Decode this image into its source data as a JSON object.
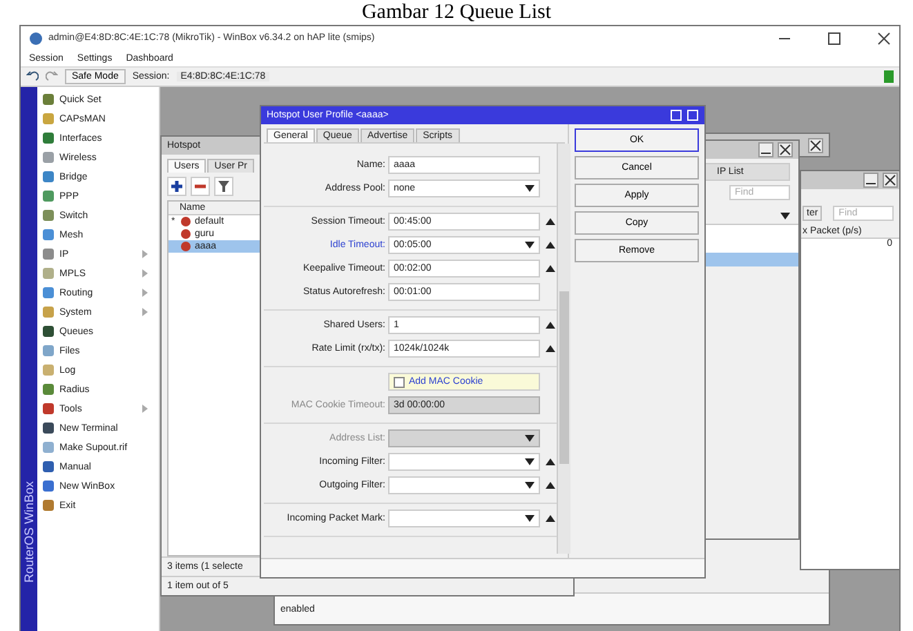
{
  "caption": "Gambar 12 Queue List",
  "window": {
    "title": "admin@E4:8D:8C:4E:1C:78 (MikroTik) - WinBox v6.34.2 on hAP lite (smips)",
    "menu": [
      "Session",
      "Settings",
      "Dashboard"
    ],
    "safe_mode": "Safe Mode",
    "session_label": "Session:",
    "session_value": "E4:8D:8C:4E:1C:78",
    "side_banner": "RouterOS WinBox"
  },
  "sidebar": {
    "items": [
      {
        "label": "Quick Set",
        "submenu": false
      },
      {
        "label": "CAPsMAN",
        "submenu": false
      },
      {
        "label": "Interfaces",
        "submenu": false
      },
      {
        "label": "Wireless",
        "submenu": false
      },
      {
        "label": "Bridge",
        "submenu": false
      },
      {
        "label": "PPP",
        "submenu": false
      },
      {
        "label": "Switch",
        "submenu": false
      },
      {
        "label": "Mesh",
        "submenu": false
      },
      {
        "label": "IP",
        "submenu": true
      },
      {
        "label": "MPLS",
        "submenu": true
      },
      {
        "label": "Routing",
        "submenu": true
      },
      {
        "label": "System",
        "submenu": true
      },
      {
        "label": "Queues",
        "submenu": false
      },
      {
        "label": "Files",
        "submenu": false
      },
      {
        "label": "Log",
        "submenu": false
      },
      {
        "label": "Radius",
        "submenu": false
      },
      {
        "label": "Tools",
        "submenu": true
      },
      {
        "label": "New Terminal",
        "submenu": false
      },
      {
        "label": "Make Supout.rif",
        "submenu": false
      },
      {
        "label": "Manual",
        "submenu": false
      },
      {
        "label": "New WinBox",
        "submenu": false
      },
      {
        "label": "Exit",
        "submenu": false
      }
    ]
  },
  "hotspot_window": {
    "title": "Hotspot",
    "tabs": [
      {
        "label": "Users",
        "selected": true
      },
      {
        "label": "User Pr",
        "selected": false
      }
    ],
    "column": "Name",
    "rows": [
      {
        "name": "default",
        "flag": "*",
        "selected": false
      },
      {
        "name": "guru",
        "selected": false
      },
      {
        "name": "aaaa",
        "selected": true
      }
    ],
    "status": "3 items (1 selecte",
    "footer": "1 item out of 5"
  },
  "back_window": {
    "status": "enabled"
  },
  "ip_list_window": {
    "label": "IP List",
    "placeholder": "Find",
    "rows": [
      {
        "selected": false
      },
      {
        "selected": false
      },
      {
        "selected": true
      }
    ]
  },
  "traffic_window": {
    "button": "ter",
    "placeholder": "Find",
    "column": "x Packet (p/s)",
    "cell": "0"
  },
  "profile_dialog": {
    "title": "Hotspot User Profile <aaaa>",
    "tabs": [
      {
        "label": "General",
        "selected": true
      },
      {
        "label": "Queue",
        "selected": false
      },
      {
        "label": "Advertise",
        "selected": false
      },
      {
        "label": "Scripts",
        "selected": false
      }
    ],
    "groups": [
      [
        {
          "kind": "field",
          "label": "Name:",
          "value": "aaaa",
          "dropdown": false,
          "collapse": false,
          "disabled": false,
          "highlight": false
        },
        {
          "kind": "field",
          "label": "Address Pool:",
          "value": "none",
          "dropdown": true,
          "collapse": false,
          "disabled": false,
          "highlight": false
        }
      ],
      [
        {
          "kind": "field",
          "label": "Session Timeout:",
          "value": "00:45:00",
          "dropdown": false,
          "collapse": true,
          "disabled": false,
          "highlight": false
        },
        {
          "kind": "field",
          "label": "Idle Timeout:",
          "value": "00:05:00",
          "dropdown": true,
          "collapse": true,
          "disabled": false,
          "highlight": true
        },
        {
          "kind": "field",
          "label": "Keepalive Timeout:",
          "value": "00:02:00",
          "dropdown": false,
          "collapse": true,
          "disabled": false,
          "highlight": false
        },
        {
          "kind": "field",
          "label": "Status Autorefresh:",
          "value": "00:01:00",
          "dropdown": false,
          "collapse": false,
          "disabled": false,
          "highlight": false
        }
      ],
      [
        {
          "kind": "field",
          "label": "Shared Users:",
          "value": "1",
          "dropdown": false,
          "collapse": true,
          "disabled": false,
          "highlight": false
        },
        {
          "kind": "field",
          "label": "Rate Limit (rx/tx):",
          "value": "1024k/1024k",
          "dropdown": false,
          "collapse": true,
          "disabled": false,
          "highlight": false
        }
      ],
      [
        {
          "kind": "checkbox",
          "label": "Add MAC Cookie",
          "checked": false
        },
        {
          "kind": "field",
          "label": "MAC Cookie Timeout:",
          "value": "3d 00:00:00",
          "dropdown": false,
          "collapse": false,
          "disabled": true,
          "highlight": false
        }
      ],
      [
        {
          "kind": "field",
          "label": "Address List:",
          "dropdown": true,
          "collapse": false,
          "disabled": true,
          "highlight": false
        },
        {
          "kind": "field",
          "label": "Incoming Filter:",
          "dropdown": true,
          "collapse": true,
          "disabled": false,
          "highlight": false
        },
        {
          "kind": "field",
          "label": "Outgoing Filter:",
          "dropdown": true,
          "collapse": true,
          "disabled": false,
          "highlight": false
        }
      ],
      [
        {
          "kind": "field",
          "label": "Incoming Packet Mark:",
          "dropdown": true,
          "collapse": true,
          "disabled": false,
          "highlight": false
        }
      ]
    ],
    "buttons": [
      "OK",
      "Cancel",
      "Apply",
      "Copy",
      "Remove"
    ]
  }
}
